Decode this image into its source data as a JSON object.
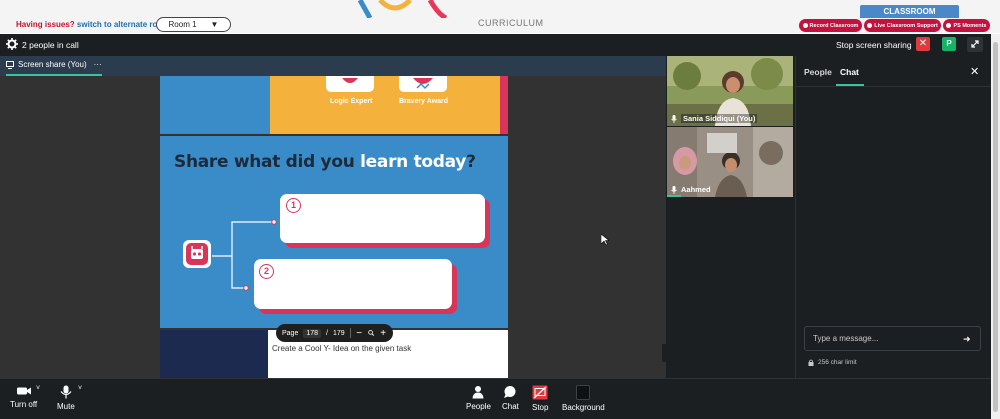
{
  "topbar": {
    "issues_text": "Having issues?",
    "alternate_link": "switch to alternate room",
    "room_value": "Room 1",
    "curriculum": "CURRICULUM",
    "classroom_tab": "CLASSROOM",
    "record_btn": "Record Classroom",
    "support_btn": "Live Classroom Support",
    "moments_btn": "PS Moments"
  },
  "call": {
    "people_count": "2 people in call",
    "stop_sharing": "Stop screen sharing",
    "user_initial": "P"
  },
  "share": {
    "tab_label": "Screen share (You)",
    "tab_menu": "···"
  },
  "slides": {
    "badge_1": "Logic Expert",
    "badge_2": "Bravery Award",
    "title_part1": "Share what did you ",
    "title_highlight": "learn today",
    "title_end": "?",
    "num_1": "1",
    "num_2": "2",
    "bottom_text": "Create a Cool Y- Idea on the given task"
  },
  "page_control": {
    "label": "Page",
    "current": "178",
    "sep": "/",
    "total": "179"
  },
  "participants": [
    {
      "name": "Sania Siddiqui (You)"
    },
    {
      "name": "Aahmed"
    }
  ],
  "side_panel": {
    "tab_people": "People",
    "tab_chat": "Chat",
    "chat_placeholder": "Type a message...",
    "char_limit": "256 char limit"
  },
  "toolbar": {
    "turn_off": "Turn off",
    "mute": "Mute",
    "people": "People",
    "chat": "Chat",
    "stop": "Stop",
    "background": "Background"
  },
  "colors": {
    "accent_green": "#3fc1a0",
    "danger_red": "#e0393e",
    "brand_red": "#c4123e",
    "slide_blue": "#3a8cc9"
  }
}
